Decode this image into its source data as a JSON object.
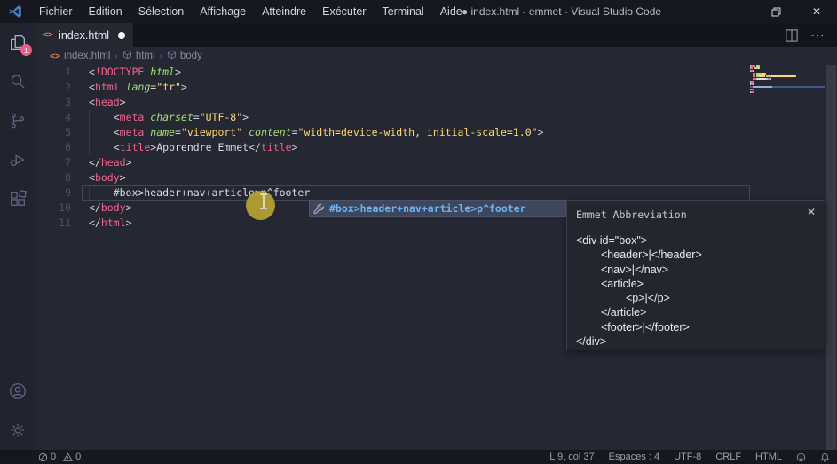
{
  "window": {
    "title": "index.html - emmet - Visual Studio Code",
    "dirty_dot": "●",
    "menus": [
      "Fichier",
      "Edition",
      "Sélection",
      "Affichage",
      "Atteindre",
      "Exécuter",
      "Terminal",
      "Aide"
    ],
    "controls": {
      "minimize": "─",
      "restore": "❐",
      "close": "✕"
    }
  },
  "activity_bar": {
    "badge": "1",
    "items": [
      "explorer",
      "search",
      "source-control",
      "run-debug",
      "extensions",
      "account",
      "settings"
    ]
  },
  "tab": {
    "label": "index.html",
    "file_icon": "<>"
  },
  "breadcrumbs": {
    "items": [
      "index.html",
      "html",
      "body"
    ],
    "separator": "›"
  },
  "code": {
    "lines": [
      {
        "num": "1",
        "tokens": [
          [
            "p",
            "<"
          ],
          [
            "t",
            "!DOCTYPE"
          ],
          [
            "x",
            " "
          ],
          [
            "a",
            "html"
          ],
          [
            "p",
            ">"
          ]
        ]
      },
      {
        "num": "2",
        "tokens": [
          [
            "p",
            "<"
          ],
          [
            "t",
            "html"
          ],
          [
            "x",
            " "
          ],
          [
            "a",
            "lang"
          ],
          [
            "p",
            "="
          ],
          [
            "s",
            "\"fr\""
          ],
          [
            "p",
            ">"
          ]
        ]
      },
      {
        "num": "3",
        "tokens": [
          [
            "p",
            "<"
          ],
          [
            "t",
            "head"
          ],
          [
            "p",
            ">"
          ]
        ]
      },
      {
        "num": "4",
        "tokens": [
          [
            "x",
            "    "
          ],
          [
            "p",
            "<"
          ],
          [
            "t",
            "meta"
          ],
          [
            "x",
            " "
          ],
          [
            "a",
            "charset"
          ],
          [
            "p",
            "="
          ],
          [
            "s",
            "\"UTF-8\""
          ],
          [
            "p",
            ">"
          ]
        ]
      },
      {
        "num": "5",
        "tokens": [
          [
            "x",
            "    "
          ],
          [
            "p",
            "<"
          ],
          [
            "t",
            "meta"
          ],
          [
            "x",
            " "
          ],
          [
            "a",
            "name"
          ],
          [
            "p",
            "="
          ],
          [
            "s",
            "\"viewport\""
          ],
          [
            "x",
            " "
          ],
          [
            "a",
            "content"
          ],
          [
            "p",
            "="
          ],
          [
            "s",
            "\"width=device-width, initial-scale=1.0\""
          ],
          [
            "p",
            ">"
          ]
        ]
      },
      {
        "num": "6",
        "tokens": [
          [
            "x",
            "    "
          ],
          [
            "p",
            "<"
          ],
          [
            "t",
            "title"
          ],
          [
            "p",
            ">"
          ],
          [
            "x",
            "Apprendre Emmet"
          ],
          [
            "p",
            "</"
          ],
          [
            "t",
            "title"
          ],
          [
            "p",
            ">"
          ]
        ]
      },
      {
        "num": "7",
        "tokens": [
          [
            "p",
            "</"
          ],
          [
            "t",
            "head"
          ],
          [
            "p",
            ">"
          ]
        ]
      },
      {
        "num": "8",
        "tokens": [
          [
            "p",
            "<"
          ],
          [
            "t",
            "body"
          ],
          [
            "p",
            ">"
          ]
        ]
      },
      {
        "num": "9",
        "tokens": [
          [
            "x",
            "    #box>header+nav+article>p^footer"
          ]
        ],
        "current": true
      },
      {
        "num": "10",
        "tokens": [
          [
            "p",
            "</"
          ],
          [
            "t",
            "body"
          ],
          [
            "p",
            ">"
          ]
        ]
      },
      {
        "num": "11",
        "tokens": [
          [
            "p",
            "</"
          ],
          [
            "t",
            "html"
          ],
          [
            "p",
            ">"
          ]
        ]
      }
    ]
  },
  "suggest": {
    "label": "#box>header+nav+article>p^footer"
  },
  "docs": {
    "title": "Emmet Abbreviation",
    "close": "✕",
    "lines": [
      {
        "indent": 0,
        "text": "<div id=\"box\">"
      },
      {
        "indent": 1,
        "text": "<header>|</header>"
      },
      {
        "indent": 1,
        "text": "<nav>|</nav>"
      },
      {
        "indent": 1,
        "text": "<article>"
      },
      {
        "indent": 2,
        "text": "<p>|</p>"
      },
      {
        "indent": 1,
        "text": "</article>"
      },
      {
        "indent": 1,
        "text": "<footer>|</footer>"
      },
      {
        "indent": 0,
        "text": "</div>"
      }
    ]
  },
  "status_bar": {
    "errors": "0",
    "warnings": "0",
    "cursor": "L 9, col 37",
    "indentation": "Espaces : 4",
    "encoding": "UTF-8",
    "eol": "CRLF",
    "language": "HTML"
  },
  "colors": {
    "accent_pink": "#f7618c",
    "attr_green": "#a8df76",
    "string_yellow": "#ffd76d",
    "suggest_blue": "#6cb3f5",
    "badge_pink": "#ef5d87",
    "cursor_halo": "#b7a42e",
    "editor_bg": "#252833",
    "chrome_bg": "#16181f"
  }
}
